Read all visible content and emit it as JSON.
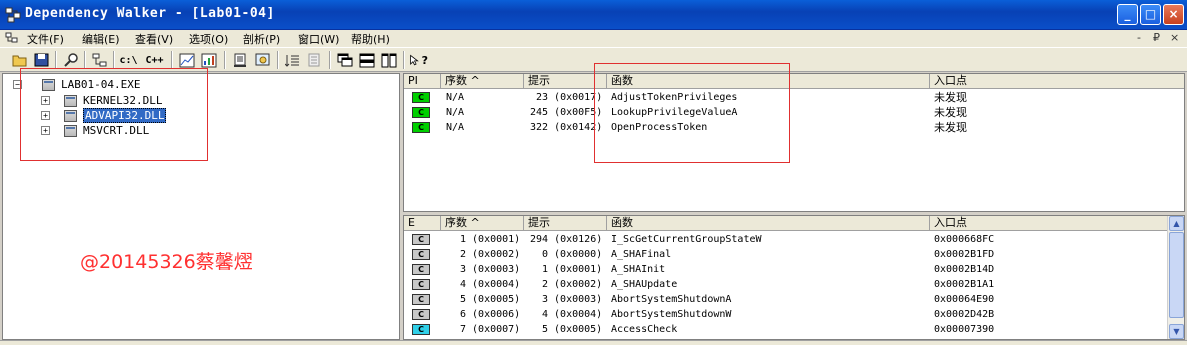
{
  "window": {
    "title": "Dependency Walker - [Lab01-04]",
    "minimize": "_",
    "maximize": "□",
    "close": "×"
  },
  "menu": {
    "items": [
      "文件(F)",
      "编辑(E)",
      "查看(V)",
      "选项(O)",
      "剖析(P)",
      "窗口(W)",
      "帮助(H)"
    ],
    "mdi": [
      "-",
      "₽",
      "×"
    ]
  },
  "toolbar": {
    "c_drive_label": "c:\\",
    "cpp_label": "C++",
    "help_label": "?"
  },
  "tree": {
    "root": {
      "expander": "−",
      "label": "LAB01-04.EXE"
    },
    "children": [
      {
        "expander": "+",
        "label": "KERNEL32.DLL"
      },
      {
        "expander": "+",
        "label": "ADVAPI32.DLL"
      },
      {
        "expander": "+",
        "label": "MSVCRT.DLL"
      }
    ]
  },
  "imports": {
    "columns": [
      "PI",
      "序数 ^",
      "提示",
      "函数",
      "入口点"
    ],
    "rows": [
      {
        "badge": "C",
        "ordinal": "N/A",
        "hint": "23 (0x0017)",
        "function": "AdjustTokenPrivileges",
        "entry": "未发现"
      },
      {
        "badge": "C",
        "ordinal": "N/A",
        "hint": "245 (0x00F5)",
        "function": "LookupPrivilegeValueA",
        "entry": "未发现"
      },
      {
        "badge": "C",
        "ordinal": "N/A",
        "hint": "322 (0x0142)",
        "function": "OpenProcessToken",
        "entry": "未发现"
      }
    ]
  },
  "exports": {
    "columns": [
      "E",
      "序数 ^",
      "提示",
      "函数",
      "入口点"
    ],
    "rows": [
      {
        "badge": "C",
        "ordinal": "1 (0x0001)",
        "hint": "294 (0x0126)",
        "function": "I_ScGetCurrentGroupStateW",
        "entry": "0x000668FC"
      },
      {
        "badge": "C",
        "ordinal": "2 (0x0002)",
        "hint": "0 (0x0000)",
        "function": "A_SHAFinal",
        "entry": "0x0002B1FD"
      },
      {
        "badge": "C",
        "ordinal": "3 (0x0003)",
        "hint": "1 (0x0001)",
        "function": "A_SHAInit",
        "entry": "0x0002B14D"
      },
      {
        "badge": "C",
        "ordinal": "4 (0x0004)",
        "hint": "2 (0x0002)",
        "function": "A_SHAUpdate",
        "entry": "0x0002B1A1"
      },
      {
        "badge": "C",
        "ordinal": "5 (0x0005)",
        "hint": "3 (0x0003)",
        "function": "AbortSystemShutdownA",
        "entry": "0x00064E90"
      },
      {
        "badge": "C",
        "ordinal": "6 (0x0006)",
        "hint": "4 (0x0004)",
        "function": "AbortSystemShutdownW",
        "entry": "0x0002D42B"
      },
      {
        "badge": "C",
        "ordinal": "7 (0x0007)",
        "hint": "5 (0x0005)",
        "function": "AccessCheck",
        "entry": "0x00007390"
      }
    ],
    "scroll_up": "▲",
    "scroll_down": "▼"
  },
  "watermark": "@20145326蔡馨熤",
  "colors": {
    "titlebar": "#0a4fc9",
    "selection": "#316ac5",
    "annotation_box": "#e03030",
    "watermark": "#ff3030",
    "badge_green": "#00d000",
    "badge_gray": "#c8c8c8",
    "badge_cyan": "#30d0e8"
  }
}
